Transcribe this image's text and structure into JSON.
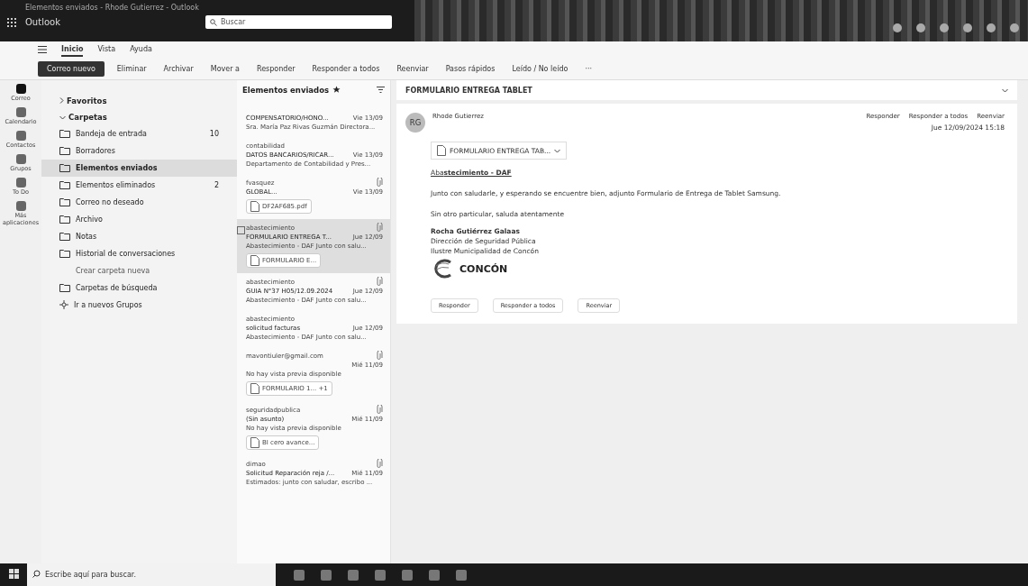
{
  "window": {
    "title": "Elementos enviados - Rhode Gutierrez - Outlook",
    "app_name": "Outlook"
  },
  "search": {
    "placeholder": "Buscar"
  },
  "rail": [
    {
      "label": "Correo",
      "selected": true
    },
    {
      "label": "Calendario",
      "selected": false
    },
    {
      "label": "Contactos",
      "selected": false
    },
    {
      "label": "Grupos",
      "selected": false
    },
    {
      "label": "To Do",
      "selected": false
    },
    {
      "label": "Más aplicaciones",
      "selected": false
    }
  ],
  "ribbon_tabs": [
    {
      "label": "Inicio",
      "selected": true
    },
    {
      "label": "Vista",
      "selected": false
    },
    {
      "label": "Ayuda",
      "selected": false
    }
  ],
  "toolbar": [
    {
      "label": "Correo nuevo",
      "kind": "primary"
    },
    {
      "label": "Eliminar",
      "kind": "plain"
    },
    {
      "label": "Archivar",
      "kind": "plain"
    },
    {
      "label": "Mover a",
      "kind": "plain"
    },
    {
      "label": "Responder",
      "kind": "plain"
    },
    {
      "label": "Responder a todos",
      "kind": "plain"
    },
    {
      "label": "Reenviar",
      "kind": "plain"
    },
    {
      "label": "Pasos rápidos",
      "kind": "plain"
    },
    {
      "label": "Leído / No leído",
      "kind": "plain"
    },
    {
      "label": "···",
      "kind": "more"
    }
  ],
  "folders": {
    "favorites": "Favoritos",
    "section": "Carpetas",
    "items": [
      {
        "label": "Bandeja de entrada",
        "count": "10",
        "kind": "folder",
        "selected": false
      },
      {
        "label": "Borradores",
        "kind": "folder",
        "selected": false
      },
      {
        "label": "Elementos enviados",
        "kind": "folder",
        "selected": true
      },
      {
        "label": "Elementos eliminados",
        "count": "2",
        "kind": "folder",
        "selected": false
      },
      {
        "label": "Correo no deseado",
        "kind": "folder",
        "selected": false
      },
      {
        "label": "Archivo",
        "kind": "folder",
        "selected": false
      },
      {
        "label": "Notas",
        "kind": "folder",
        "selected": false
      },
      {
        "label": "Historial de conversaciones",
        "kind": "folder",
        "selected": false
      },
      {
        "label": "Crear carpeta nueva",
        "kind": "link",
        "selected": false
      },
      {
        "label": "Carpetas de búsqueda",
        "kind": "folder",
        "selected": false
      },
      {
        "label": "Ir a nuevos Grupos",
        "kind": "groups",
        "selected": false
      }
    ]
  },
  "mail_list": {
    "title": "Elementos enviados",
    "items": [
      {
        "subject": "COMPENSATORIO/HONO...",
        "date": "Vie 13/09",
        "preview": "Sra. María Paz Rivas Guzmán Directora...",
        "paperclip": false,
        "selected": false
      },
      {
        "from": "contabilidad",
        "subject": "DATOS BANCARIOS/RICAR...",
        "date": "Vie 13/09",
        "preview": "Departamento de Contabilidad y Pres...",
        "paperclip": false,
        "selected": false
      },
      {
        "from": "fvasquez",
        "subject": "GLOBAL...",
        "date": "Vie 13/09",
        "attachment": "DF2AF685.pdf",
        "paperclip": true,
        "selected": false
      },
      {
        "from": "abastecimiento",
        "subject": "FORMULARIO ENTREGA T...",
        "date": "Jue 12/09",
        "preview": "Abastecimiento - DAF Junto con salu...",
        "attachment": "FORMULARIO E...",
        "paperclip": true,
        "selected": true
      },
      {
        "from": "abastecimiento",
        "subject": "GUIA N°37 H05/12.09.2024",
        "date": "Jue 12/09",
        "preview": "Abastecimiento - DAF Junto con salu...",
        "paperclip": true,
        "selected": false
      },
      {
        "from": "abastecimiento",
        "subject": "solicitud facturas",
        "date": "Jue 12/09",
        "preview": "Abastecimiento - DAF Junto con salu...",
        "paperclip": false,
        "selected": false
      },
      {
        "from": "mavontiuler@gmail.com",
        "date": "Mié 11/09",
        "preview": "No hay vista previa disponible",
        "attachment": "FORMULARIO 1...",
        "extra": "+1",
        "paperclip": true,
        "selected": false
      },
      {
        "from": "seguridadpublica",
        "subject": "(Sin asunto)",
        "date": "Mié 11/09",
        "preview": "No hay vista previa disponible",
        "attachment": "BI cero avance...",
        "paperclip": true,
        "selected": false
      },
      {
        "from": "dimao",
        "subject": "Solicitud Reparación reja /...",
        "date": "Mié 11/09",
        "preview": "Estimados: junto con saludar, escribo ...",
        "paperclip": true,
        "selected": false
      }
    ]
  },
  "reading_pane": {
    "subject": "FORMULARIO ENTREGA TABLET",
    "initials": "RG",
    "sender": "Rhode Gutierrez",
    "actions": [
      "Responder",
      "Responder a todos",
      "Reenviar"
    ],
    "date": "Jue 12/09/2024 15:18",
    "attachment": "FORMULARIO ENTREGA TAB...",
    "body": [
      {
        "kind": "heading",
        "text": "Aba**stecimiento - DAF**"
      },
      {
        "kind": "para",
        "text": "Junto con saludarle, y esperando se encuentre bien, adjunto Formulario de Entrega de Tablet Samsung."
      },
      {
        "kind": "para",
        "text": "Sin otro particular, saluda atentamente"
      }
    ],
    "signature": {
      "name": "Rocha Gutiérrez Galaas",
      "lines": [
        "Dirección de Seguridad Pública",
        "Ilustre Municipalidad de Concón"
      ],
      "logo": "CONCÓN"
    },
    "footer_actions": [
      "Responder",
      "Responder a todos",
      "Reenviar"
    ]
  },
  "taskbar": {
    "search_placeholder": "Escribe aquí para buscar."
  }
}
